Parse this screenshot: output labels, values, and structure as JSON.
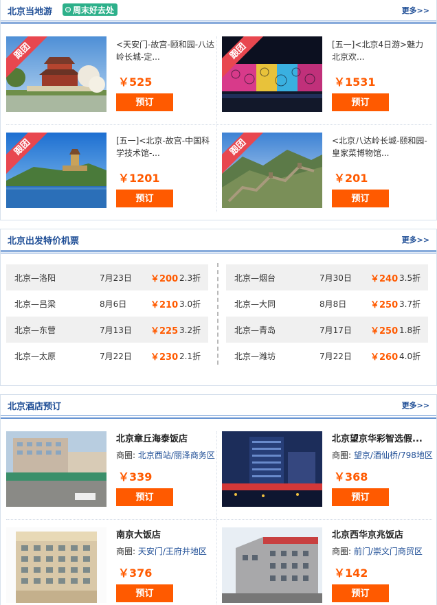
{
  "sections": {
    "tours": {
      "title": "北京当地游",
      "tag": "周末好去处",
      "more": "更多>>",
      "items": [
        {
          "ribbon": "跟团",
          "title": "<天安门-故宫-颐和园-八达岭长城-定...",
          "price": "￥525",
          "button": "预订"
        },
        {
          "ribbon": "跟团",
          "title": "[五一]<北京4日游>魅力北京欢...",
          "price": "￥1531",
          "button": "预订"
        },
        {
          "ribbon": "跟团",
          "title": "[五一]<北京-故宫-中国科学技术馆-...",
          "price": "￥1201",
          "button": "预订"
        },
        {
          "ribbon": "跟团",
          "title": "<北京八达岭长城-颐和园-皇家菜博物馆...",
          "price": "￥201",
          "button": "预订"
        }
      ]
    },
    "flights": {
      "title": "北京出发特价机票",
      "more": "更多>>",
      "left": [
        {
          "route": "北京—洛阳",
          "date": "7月23日",
          "price": "￥200",
          "discount": "2.3折"
        },
        {
          "route": "北京—吕梁",
          "date": "8月6日",
          "price": "￥210",
          "discount": "3.0折"
        },
        {
          "route": "北京—东营",
          "date": "7月13日",
          "price": "￥225",
          "discount": "3.2折"
        },
        {
          "route": "北京—太原",
          "date": "7月22日",
          "price": "￥230",
          "discount": "2.1折"
        }
      ],
      "right": [
        {
          "route": "北京—烟台",
          "date": "7月30日",
          "price": "￥240",
          "discount": "3.5折"
        },
        {
          "route": "北京—大同",
          "date": "8月8日",
          "price": "￥250",
          "discount": "3.7折"
        },
        {
          "route": "北京—青岛",
          "date": "7月17日",
          "price": "￥250",
          "discount": "1.8折"
        },
        {
          "route": "北京—潍坊",
          "date": "7月22日",
          "price": "￥260",
          "discount": "4.0折"
        }
      ]
    },
    "hotels": {
      "title": "北京酒店预订",
      "more": "更多>>",
      "area_label": "商圈:",
      "items": [
        {
          "name": "北京章丘海泰饭店",
          "area": "北京西站/丽泽商务区",
          "price": "￥339",
          "button": "预订"
        },
        {
          "name": "北京望京华彩智选假...",
          "area": "望京/酒仙桥/798地区",
          "price": "￥368",
          "button": "预订"
        },
        {
          "name": "南京大饭店",
          "area": "天安门/王府井地区",
          "price": "￥376",
          "button": "预订"
        },
        {
          "name": "北京西华京兆饭店",
          "area": "前门/崇文门商贸区",
          "price": "￥142",
          "button": "预订"
        }
      ]
    }
  },
  "colors": {
    "accent": "#ff5a00",
    "link": "#1f4e96",
    "tag": "#2db08a",
    "ribbon": "#e8474f"
  }
}
